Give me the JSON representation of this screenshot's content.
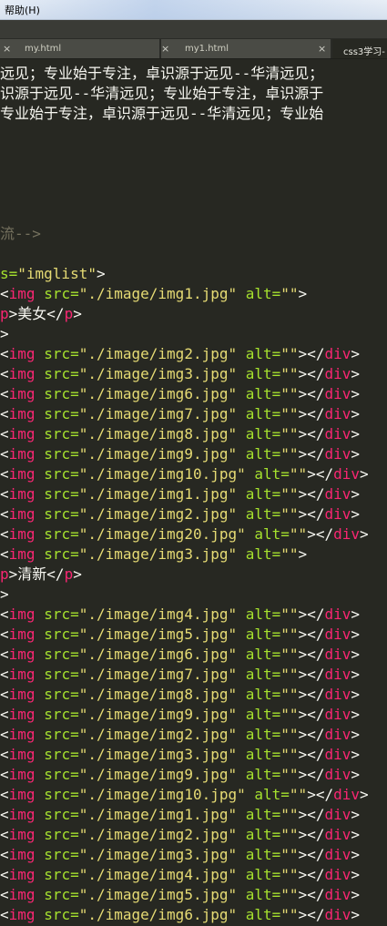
{
  "menubar": {
    "help": "帮助(H)"
  },
  "tabs": [
    {
      "label": "my.html",
      "close": "×"
    },
    {
      "label": "my1.html",
      "close": "×"
    },
    {
      "label": "css3学习-",
      "close": "×"
    }
  ],
  "colors": {
    "background": "#272822",
    "tag": "#f92672",
    "attr": "#a6e22e",
    "string": "#e6db74",
    "comment": "#75715e",
    "text": "#f8f8f2"
  },
  "code": {
    "text_lines": [
      "远见；专业始于专注，卓识源于远见--华清远见；",
      "识源于远见--华清远见；专业始于专注，卓识源于",
      "专业始于专注，卓识源于远见--华清远见；专业始"
    ],
    "comment": "流-->",
    "imglist_attr": "s=",
    "imglist_val": "\"imglist\"",
    "gt": ">",
    "lt": "<",
    "lt_slash": "</",
    "p_open_tail": "p",
    "p_tag": "p",
    "meinv": "美女",
    "qingxin": "清新",
    "img": "img",
    "src_attr": "src=",
    "alt_attr": "alt=",
    "alt_val": "\"\"",
    "div": "div",
    "srcs_a": [
      "\"./image/img2.jpg\"",
      "\"./image/img3.jpg\"",
      "\"./image/img6.jpg\"",
      "\"./image/img7.jpg\"",
      "\"./image/img8.jpg\"",
      "\"./image/img9.jpg\"",
      "\"./image/img10.jpg\"",
      "\"./image/img1.jpg\"",
      "\"./image/img2.jpg\"",
      "\"./image/img20.jpg\""
    ],
    "src_first_a": "\"./image/img1.jpg\"",
    "src_first_b": "\"./image/img3.jpg\"",
    "srcs_b": [
      "\"./image/img4.jpg\"",
      "\"./image/img5.jpg\"",
      "\"./image/img6.jpg\"",
      "\"./image/img7.jpg\"",
      "\"./image/img8.jpg\"",
      "\"./image/img9.jpg\"",
      "\"./image/img2.jpg\"",
      "\"./image/img3.jpg\"",
      "\"./image/img9.jpg\"",
      "\"./image/img10.jpg\"",
      "\"./image/img1.jpg\"",
      "\"./image/img2.jpg\"",
      "\"./image/img3.jpg\"",
      "\"./image/img4.jpg\"",
      "\"./image/img5.jpg\"",
      "\"./image/img6.jpg\""
    ]
  }
}
